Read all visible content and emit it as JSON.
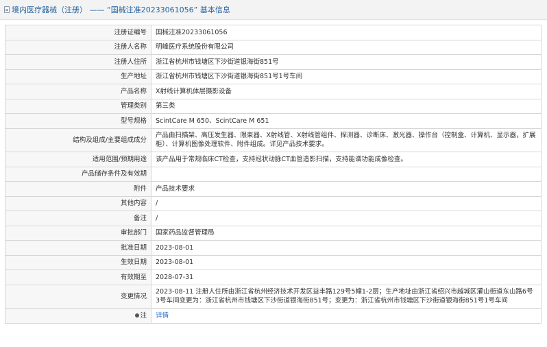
{
  "header": {
    "title": "境内医疗器械（注册） —— “国械注准20233061056” 基本信息"
  },
  "rows": [
    {
      "label": "注册证编号",
      "value": "国械注准20233061056"
    },
    {
      "label": "注册人名称",
      "value": "明峰医疗系统股份有限公司"
    },
    {
      "label": "注册人住所",
      "value": "浙江省杭州市钱塘区下沙街道银海街851号"
    },
    {
      "label": "生产地址",
      "value": "浙江省杭州市钱塘区下沙街道银海街851号1号车间"
    },
    {
      "label": "产品名称",
      "value": "X射线计算机体层摄影设备"
    },
    {
      "label": "管理类别",
      "value": "第三类"
    },
    {
      "label": "型号规格",
      "value": "ScintCare M 650、ScintCare M 651"
    },
    {
      "label": "结构及组成/主要组成成分",
      "value": "产品由扫描架、高压发生器、限束器、X射线管、X射线管组件、探测器、诊断床、激光器、操作台（控制盒、计算机、显示器，扩展柜）、计算机图像处理软件、附件组成。详见产品技术要求。"
    },
    {
      "label": "适用范围/预期用途",
      "value": "该产品用于常规临床CT检查，支持冠状动脉CT血管造影扫描，支持能谱功能成像检查。"
    },
    {
      "label": "产品储存条件及有效期",
      "value": ""
    },
    {
      "label": "附件",
      "value": "产品技术要求"
    },
    {
      "label": "其他内容",
      "value": "/"
    },
    {
      "label": "备注",
      "value": "/"
    },
    {
      "label": "审批部门",
      "value": "国家药品监督管理局"
    },
    {
      "label": "批准日期",
      "value": "2023-08-01"
    },
    {
      "label": "生效日期",
      "value": "2023-08-01"
    },
    {
      "label": "有效期至",
      "value": "2028-07-31"
    },
    {
      "label": "变更情况",
      "value": "2023-08-11 注册人住所由浙江省杭州经济技术开发区益丰路129号5幢1-2层；生产地址由浙江省绍兴市越城区灌山街道东山路6号3号车间变更为：浙江省杭州市钱塘区下沙街道银海街851号；变更为：浙江省杭州市钱塘区下沙街道银海街851号1号车间"
    }
  ],
  "note": {
    "label": "注",
    "link": "详情"
  }
}
